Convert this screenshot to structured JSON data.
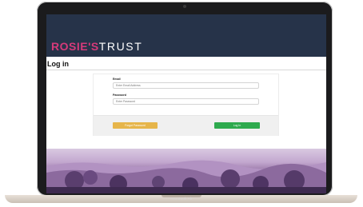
{
  "device": {
    "brand_label": "MacBook Air"
  },
  "site": {
    "logo_primary": "ROSIE'S",
    "logo_secondary": "TRUST",
    "header_color": "#263349",
    "accent_color": "#d63a7a"
  },
  "page": {
    "title": "Log in"
  },
  "login_form": {
    "email_label": "Email",
    "email_placeholder": "Enter Email Address",
    "password_label": "Password",
    "password_placeholder": "Enter Password",
    "forgot_button_label": "Forgot Password",
    "forgot_button_color": "#e6b54a",
    "login_button_label": "Log In",
    "login_button_color": "#2eaa4e"
  }
}
